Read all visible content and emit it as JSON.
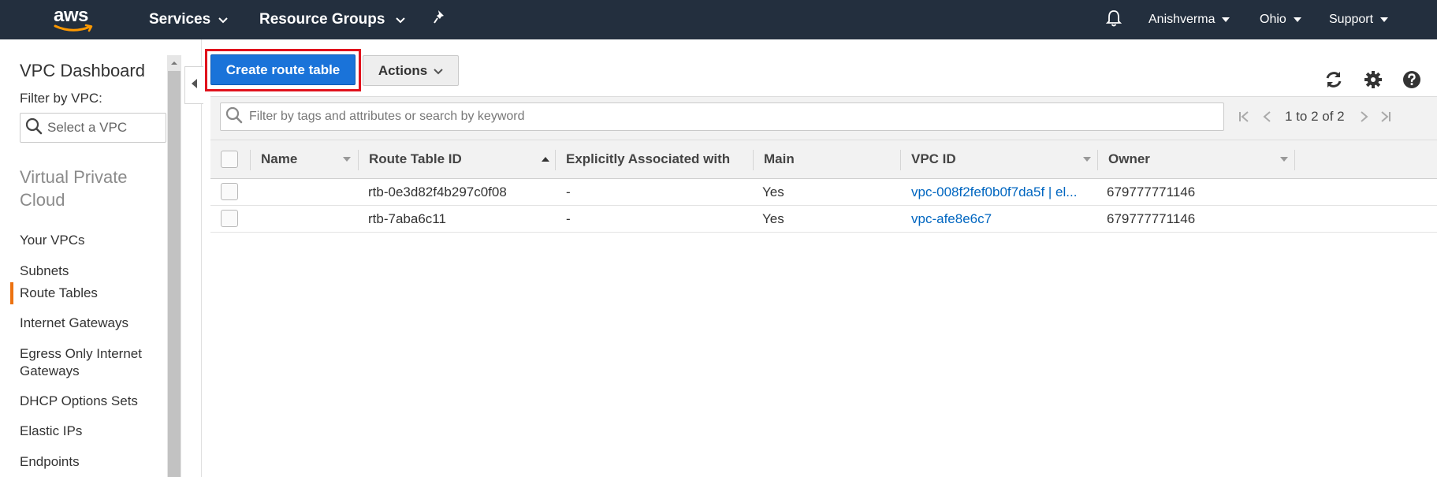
{
  "nav": {
    "logo": "aws",
    "services": "Services",
    "resource_groups": "Resource Groups",
    "user": "Anishverma",
    "region": "Ohio",
    "support": "Support"
  },
  "sidebar": {
    "title": "VPC Dashboard",
    "filter_label": "Filter by VPC:",
    "filter_placeholder": "Select a VPC",
    "section": "Virtual Private Cloud",
    "items": [
      {
        "label": "Your VPCs"
      },
      {
        "label": "Subnets"
      },
      {
        "label": "Route Tables",
        "active": true
      },
      {
        "label": "Internet Gateways"
      },
      {
        "label": "Egress Only Internet Gateways"
      },
      {
        "label": "DHCP Options Sets"
      },
      {
        "label": "Elastic IPs"
      },
      {
        "label": "Endpoints"
      }
    ]
  },
  "toolbar": {
    "create_label": "Create route table",
    "actions_label": "Actions"
  },
  "search": {
    "placeholder": "Filter by tags and attributes or search by keyword"
  },
  "pager": {
    "text": "1 to 2 of 2"
  },
  "table": {
    "columns": [
      "Name",
      "Route Table ID",
      "Explicitly Associated with",
      "Main",
      "VPC ID",
      "Owner"
    ],
    "rows": [
      {
        "name": "",
        "route_table_id": "rtb-0e3d82f4b297c0f08",
        "associated": "-",
        "main": "Yes",
        "vpc_id": "vpc-008f2fef0b0f7da5f | el...",
        "owner": "679777771146"
      },
      {
        "name": "",
        "route_table_id": "rtb-7aba6c11",
        "associated": "-",
        "main": "Yes",
        "vpc_id": "vpc-afe8e6c7",
        "owner": "679777771146"
      }
    ]
  },
  "colors": {
    "nav_bg": "#232f3e",
    "primary": "#1a73d9",
    "highlight": "#e0121c",
    "active_accent": "#ec7211",
    "link": "#0066c0"
  }
}
